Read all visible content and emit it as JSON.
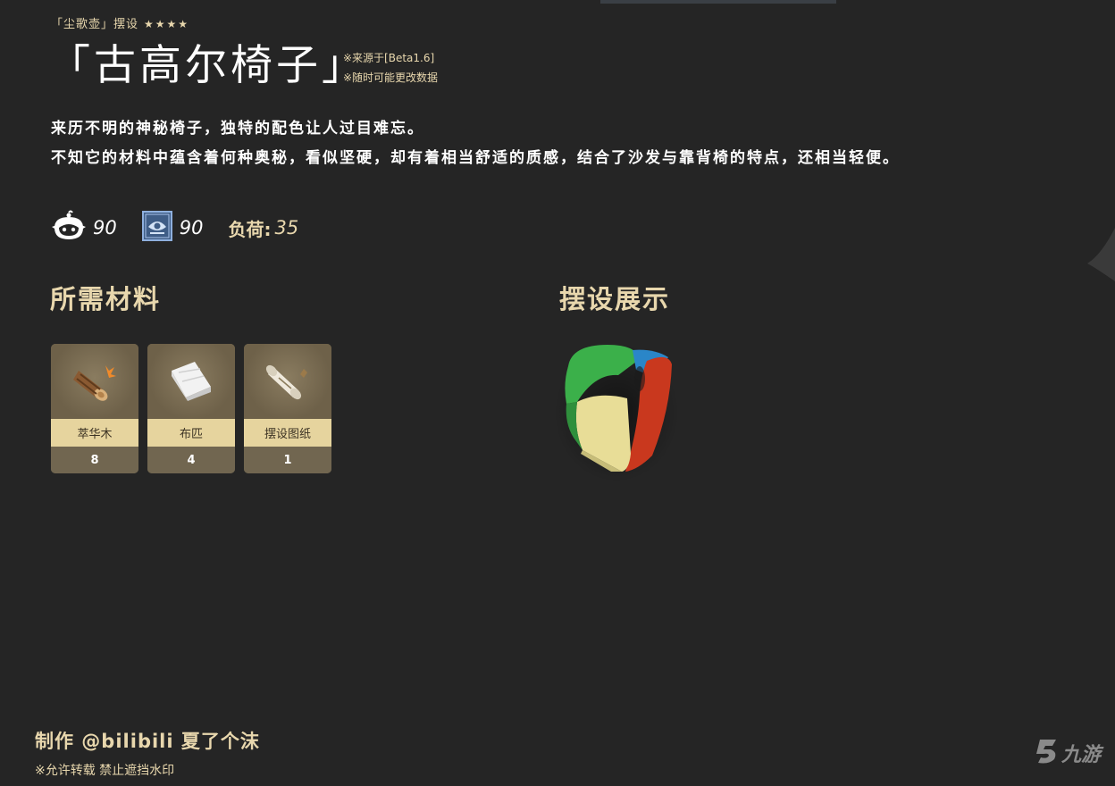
{
  "header": {
    "category": "「尘歌壶」摆设",
    "stars": "★★★★",
    "title": "「古高尔椅子」",
    "source_note": "※来源于[Beta1.6]",
    "change_note": "※随时可能更改数据"
  },
  "description": {
    "line1": "来历不明的神秘椅子，独特的配色让人过目难忘。",
    "line2": "不知它的材料中蕴含着何种奥秘，看似坚硬，却有着相当舒适的质感，结合了沙发与靠背椅的特点，还相当轻便。"
  },
  "stats": {
    "adeptal_energy": "90",
    "comfort": "90",
    "load_label": "负荷:",
    "load_value": "35"
  },
  "sections": {
    "materials_title": "所需材料",
    "showcase_title": "摆设展示"
  },
  "materials": [
    {
      "name": "萃华木",
      "count": "8",
      "icon": "wood-icon"
    },
    {
      "name": "布匹",
      "count": "4",
      "icon": "fabric-icon"
    },
    {
      "name": "摆设图纸",
      "count": "1",
      "icon": "blueprint-icon"
    }
  ],
  "footer": {
    "credit": "制作 @bilibili 夏了个沫",
    "license": "※允许转载 禁止遮挡水印",
    "watermark": "九游"
  },
  "colors": {
    "background": "#252525",
    "accent_gold": "#e8d7ad",
    "card_label": "#e6d49e"
  }
}
